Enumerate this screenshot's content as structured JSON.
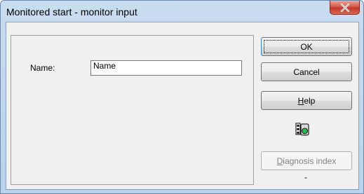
{
  "window": {
    "title": "Monitored start - monitor input"
  },
  "form": {
    "name_label": "Name:",
    "name_value": "Name"
  },
  "buttons": {
    "ok": "OK",
    "cancel": "Cancel",
    "help_mnemonic": "H",
    "help_rest": "elp",
    "diagnosis_mnemonic": "D",
    "diagnosis_rest": "iagnosis index"
  },
  "status": {
    "diagnosis_value": "-"
  },
  "icons": {
    "close": "close-icon",
    "monitor": "monitor-status-icon"
  },
  "colors": {
    "monitor_green": "#2fb84a",
    "close_red": "#c0392b"
  }
}
